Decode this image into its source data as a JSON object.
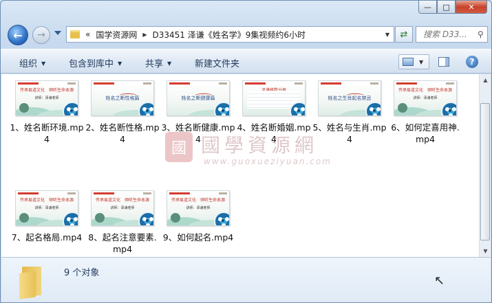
{
  "window": {
    "caption": {
      "minimize": "—",
      "maximize": "□",
      "close": "✕"
    }
  },
  "nav": {
    "back_icon": "arrow-left-icon",
    "forward_icon": "arrow-right-icon",
    "breadcrumb": {
      "overflow": "«",
      "parts": [
        "国学资源网",
        "D33451 泽谦《姓名学》9集视频约6小时"
      ]
    },
    "refresh_icon": "refresh-icon",
    "search": {
      "placeholder": "搜索 D33...",
      "icon": "search-icon"
    }
  },
  "toolbar": {
    "organize": "组织",
    "include_in_library": "包含到库中",
    "share": "共享",
    "new_folder": "新建文件夹"
  },
  "files": [
    {
      "name": "1、姓名断环境.mp4",
      "thumb": "传承易道文化　倾听生命本源"
    },
    {
      "name": "2、姓名断性格.mp4",
      "thumb": "姓名之断性格篇"
    },
    {
      "name": "3、姓名断健康.mp4",
      "thumb": "姓名之断健康篇"
    },
    {
      "name": "4、姓名断婚姻.mp4",
      "thumb": "泽谦格数分类"
    },
    {
      "name": "5、姓名与生肖.mp4",
      "thumb": "姓名之生肖起名禁忌"
    },
    {
      "name": "6、如何定喜用神.mp4",
      "thumb": "传承易道文化　倾听生命本源"
    },
    {
      "name": "7、起名格局.mp4",
      "thumb": "传承易道文化　倾听生命本源"
    },
    {
      "name": "8、起名注意要素.mp4",
      "thumb": "传承易道文化　倾听生命本源"
    },
    {
      "name": "9、如何起名.mp4",
      "thumb": "传承易道文化　倾听生命本源"
    }
  ],
  "thumb_sub": "讲师：泽谦老师",
  "watermark": {
    "cn": "國學資源網",
    "en": "www.guoxueziyuan.com",
    "seal": "國"
  },
  "details": {
    "count": "9 个对象"
  }
}
